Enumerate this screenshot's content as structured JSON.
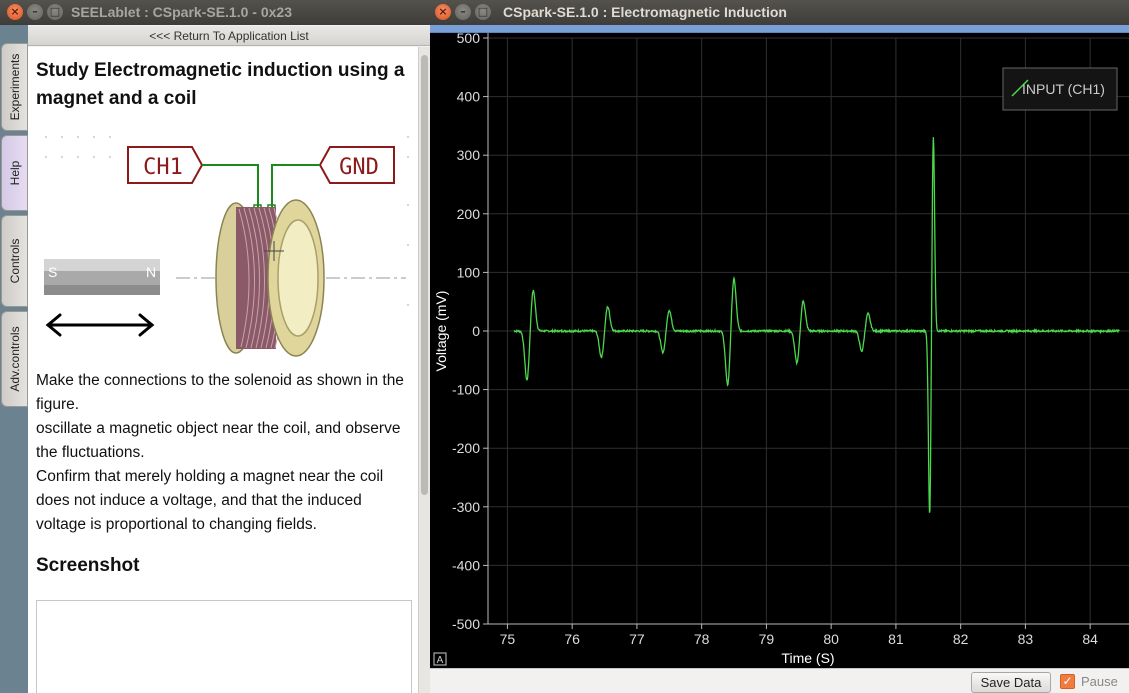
{
  "left_window": {
    "title": "SEELablet : CSpark-SE.1.0 - 0x23",
    "side_tabs": [
      "Experiments",
      "Help",
      "Controls",
      "Adv.controls"
    ],
    "return_label": "<<< Return To Application List",
    "help": {
      "title": "Study Electromagnetic induction using a magnet and a coil",
      "diagram": {
        "ch1_label": "CH1",
        "gnd_label": "GND",
        "magnet_s": "S",
        "magnet_n": "N"
      },
      "paragraphs": [
        "Make the connections to the solenoid as shown in the figure.",
        "oscillate a magnetic object near the coil, and observe the fluctuations.",
        "Confirm that merely holding a magnet near the coil does not induce a voltage, and that the induced voltage is proportional to changing fields."
      ],
      "screenshot_heading": "Screenshot"
    }
  },
  "right_window": {
    "title": "CSpark-SE.1.0 : Electromagnetic Induction",
    "save_label": "Save Data",
    "pause_label": "Pause",
    "pause_checked": true,
    "autoscale_label": "A"
  },
  "chart_data": {
    "type": "line",
    "xlabel": "Time (S)",
    "ylabel": "Voltage (mV)",
    "xlim": [
      74.7,
      84.6
    ],
    "ylim": [
      -500,
      500
    ],
    "xticks": [
      75,
      76,
      77,
      78,
      79,
      80,
      81,
      82,
      83,
      84
    ],
    "yticks": [
      500,
      400,
      300,
      200,
      100,
      0,
      -100,
      -200,
      -300,
      -400,
      -500
    ],
    "grid": true,
    "legend_position": "top-right",
    "line_color": "#4cd94c",
    "series": [
      {
        "name": "INPUT (CH1)",
        "baseline_x": [
          75.1,
          84.45
        ],
        "pulses": [
          {
            "t": 75.35,
            "min": -85,
            "max": 70
          },
          {
            "t": 76.5,
            "min": -45,
            "max": 42
          },
          {
            "t": 77.45,
            "min": -37,
            "max": 36
          },
          {
            "t": 78.45,
            "min": -93,
            "max": 90
          },
          {
            "t": 79.52,
            "min": -55,
            "max": 52
          },
          {
            "t": 80.52,
            "min": -35,
            "max": 30
          },
          {
            "t": 81.55,
            "min": -318,
            "max": 335
          }
        ]
      }
    ]
  }
}
